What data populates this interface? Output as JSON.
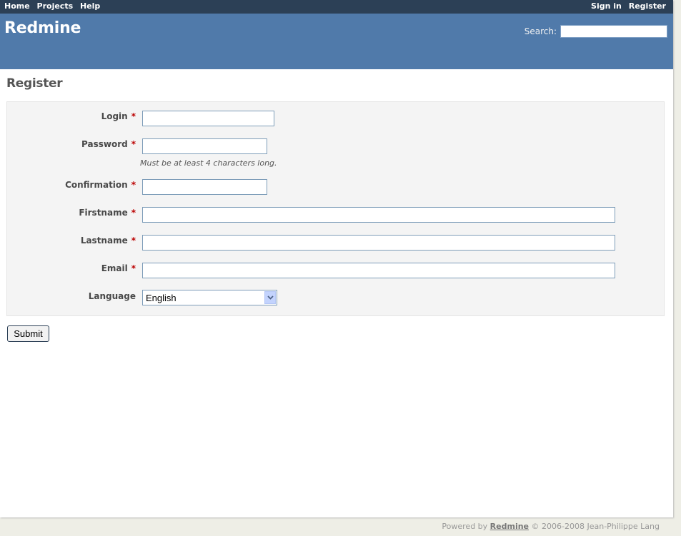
{
  "top_menu": {
    "left": [
      {
        "label": "Home"
      },
      {
        "label": "Projects"
      },
      {
        "label": "Help"
      }
    ],
    "right": [
      {
        "label": "Sign in"
      },
      {
        "label": "Register"
      }
    ]
  },
  "header": {
    "title": "Redmine",
    "search_label": "Search:",
    "search_value": ""
  },
  "page": {
    "title": "Register"
  },
  "form": {
    "required_mark": "*",
    "login": {
      "label": "Login",
      "value": ""
    },
    "password": {
      "label": "Password",
      "value": "",
      "hint": "Must be at least 4 characters long."
    },
    "confirmation": {
      "label": "Confirmation",
      "value": ""
    },
    "firstname": {
      "label": "Firstname",
      "value": ""
    },
    "lastname": {
      "label": "Lastname",
      "value": ""
    },
    "email": {
      "label": "Email",
      "value": ""
    },
    "language": {
      "label": "Language",
      "selected": "English"
    },
    "submit_label": "Submit"
  },
  "footer": {
    "prefix": "Powered by",
    "link": "Redmine",
    "suffix": "© 2006-2008 Jean-Philippe Lang"
  },
  "colors": {
    "top_menu_bg": "#2C4056",
    "header_bg": "#507AAA",
    "required": "#bb0000",
    "page_bg": "#EEEEE6"
  },
  "icons": {
    "language_dropdown": "chevron-down-icon"
  }
}
